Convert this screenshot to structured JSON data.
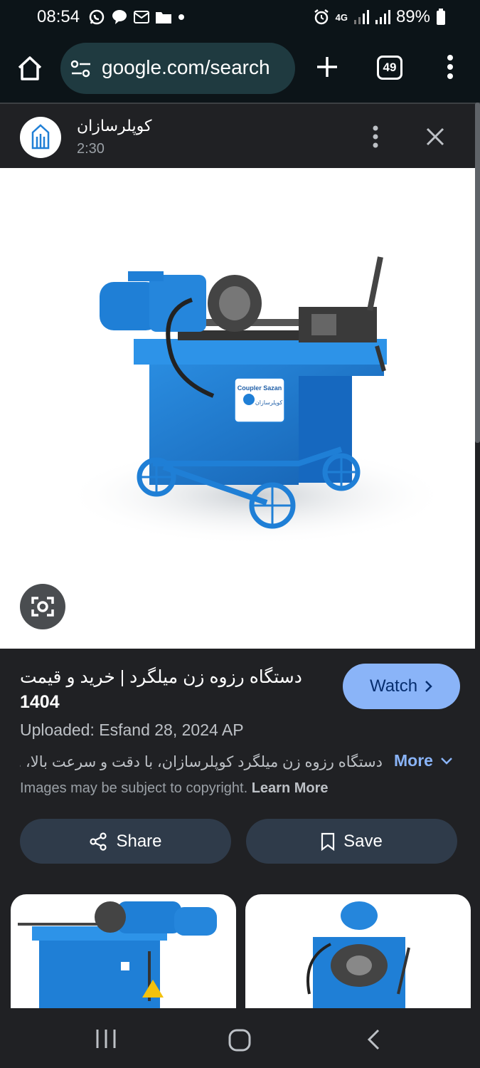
{
  "status": {
    "time": "08:54",
    "network": "4G",
    "battery": "89%"
  },
  "browser": {
    "url": "google.com/search",
    "tab_count": "49"
  },
  "media": {
    "channel": "کوپلرسازان",
    "duration": "2:30",
    "title_text": "دستگاه رزوه زن میلگرد | خرید و قیمت",
    "title_year": "1404",
    "watch_label": "Watch",
    "uploaded": "Uploaded: Esfand 28, 2024 AP",
    "description": "دستگاه رزوه زن میلگرد کوپلرسازان، با دقت و سرعت بالا، ...",
    "more_label": "More",
    "copyright_text": "Images may be subject to copyright.",
    "learn_more": "Learn More",
    "share_label": "Share",
    "save_label": "Save",
    "machine_label_top": "Coupler Sazan",
    "machine_label_bottom": "کوپلرسازان"
  },
  "colors": {
    "accent": "#8ab4f8",
    "machine_blue": "#1f7fd6",
    "background": "#202124"
  }
}
